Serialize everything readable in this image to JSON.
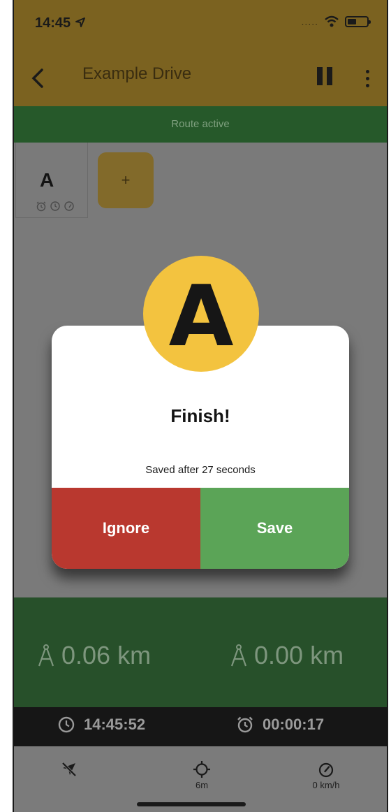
{
  "status_bar": {
    "time": "14:45",
    "dots": "....."
  },
  "header": {
    "title": "Example Drive"
  },
  "route_banner": "Route active",
  "checkpoint": {
    "letter": "A"
  },
  "add_button": {
    "label": "+"
  },
  "dialog": {
    "badge_letter": "A",
    "title": "Finish!",
    "message": "Saved after 27 seconds",
    "ignore_label": "Ignore",
    "save_label": "Save"
  },
  "stats": {
    "distance_left": "0.06 km",
    "distance_right": "0.00 km"
  },
  "time_bar": {
    "clock_time": "14:45:52",
    "elapsed": "00:00:17"
  },
  "bottom_bar": {
    "gps_accuracy": "6m",
    "speed": "0 km/h"
  },
  "colors": {
    "accent_yellow": "#f3c33f",
    "ignore_red": "#b9382f",
    "save_green": "#5ba457",
    "route_green": "#26592a"
  }
}
